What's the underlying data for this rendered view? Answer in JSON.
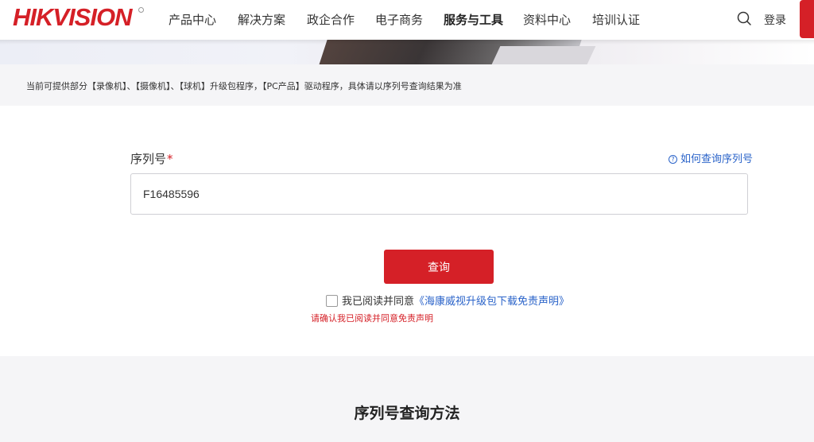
{
  "header": {
    "logo": "HIKVISION",
    "nav": [
      {
        "label": "产品中心"
      },
      {
        "label": "解决方案"
      },
      {
        "label": "政企合作"
      },
      {
        "label": "电子商务"
      },
      {
        "label": "服务与工具",
        "active": true
      },
      {
        "label": "资料中心"
      },
      {
        "label": "培训认证"
      }
    ],
    "login_label": "登录",
    "search_icon": "search-icon",
    "accent_color": "#d52027"
  },
  "notice": {
    "text": "当前可提供部分【录像机】、【摄像机】、【球机】升级包程序，【PC产品】驱动程序，具体请以序列号查询结果为准"
  },
  "form": {
    "label": "序列号",
    "required_mark": "*",
    "help_link": "如何查询序列号",
    "help_icon_glyph": "?",
    "serial_value": "F16485596",
    "submit_label": "查询",
    "agree_text": "我已阅读并同意",
    "agree_link": "《海康威视升级包下载免责声明》",
    "agree_checked": false,
    "error_text": "请确认我已阅读并同意免责声明"
  },
  "method": {
    "title": "序列号查询方法"
  }
}
